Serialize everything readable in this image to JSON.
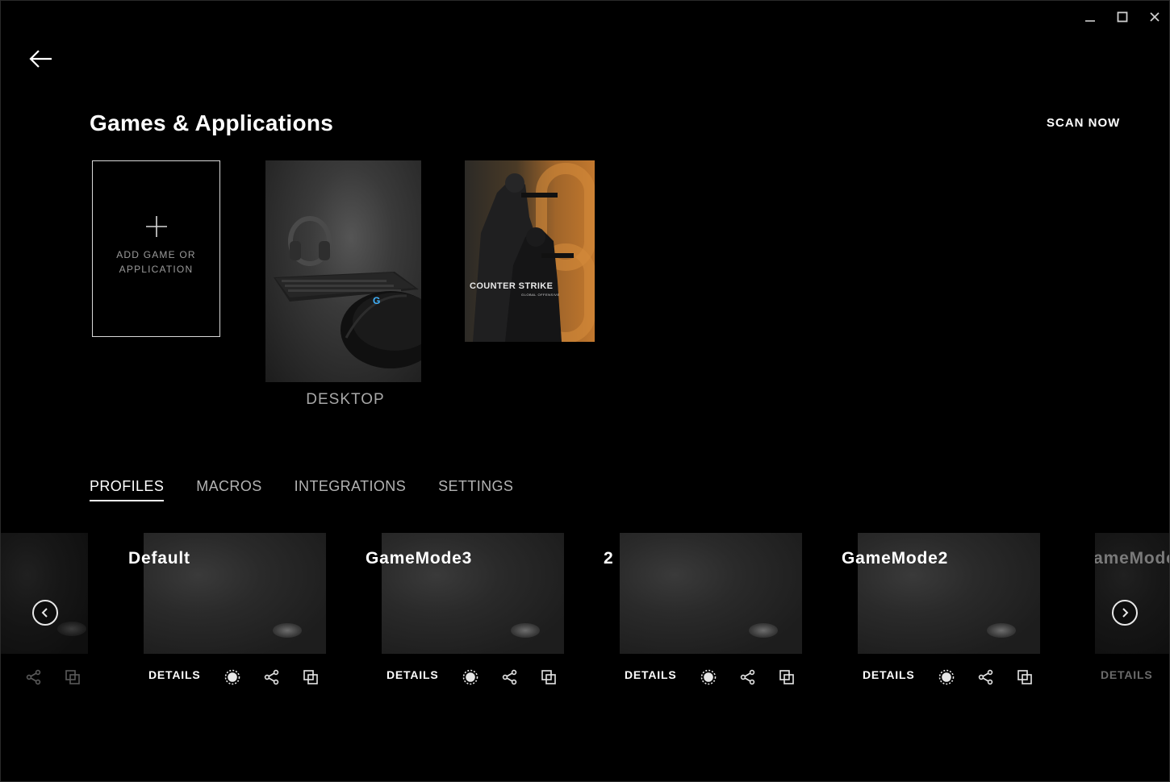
{
  "window": {
    "min_icon": "minimize-icon",
    "max_icon": "maximize-icon",
    "close_icon": "close-icon"
  },
  "header": {
    "back_icon": "back-arrow-icon",
    "title": "Games & Applications",
    "scan_label": "SCAN NOW"
  },
  "games": {
    "add_label": "ADD GAME OR APPLICATION",
    "desktop_label": "DESKTOP",
    "cs_title": "COUNTER STRIKE",
    "cs_subtitle": "GLOBAL OFFENSIVE"
  },
  "tabs": [
    {
      "label": "PROFILES",
      "active": true
    },
    {
      "label": "MACROS",
      "active": false
    },
    {
      "label": "INTEGRATIONS",
      "active": false
    },
    {
      "label": "SETTINGS",
      "active": false
    }
  ],
  "profiles": [
    {
      "name": "Default",
      "details_label": "DETAILS"
    },
    {
      "name": "GameMode3",
      "details_label": "DETAILS"
    },
    {
      "name": "2",
      "details_label": "DETAILS"
    },
    {
      "name": "GameMode2",
      "details_label": "DETAILS"
    },
    {
      "name": "GameMode",
      "details_label": "DETAILS"
    }
  ],
  "carousel": {
    "prev_icon": "chevron-left-circle-icon",
    "next_icon": "chevron-right-circle-icon"
  },
  "profile_icons": [
    "lighting-icon",
    "share-icon",
    "copy-icon"
  ]
}
